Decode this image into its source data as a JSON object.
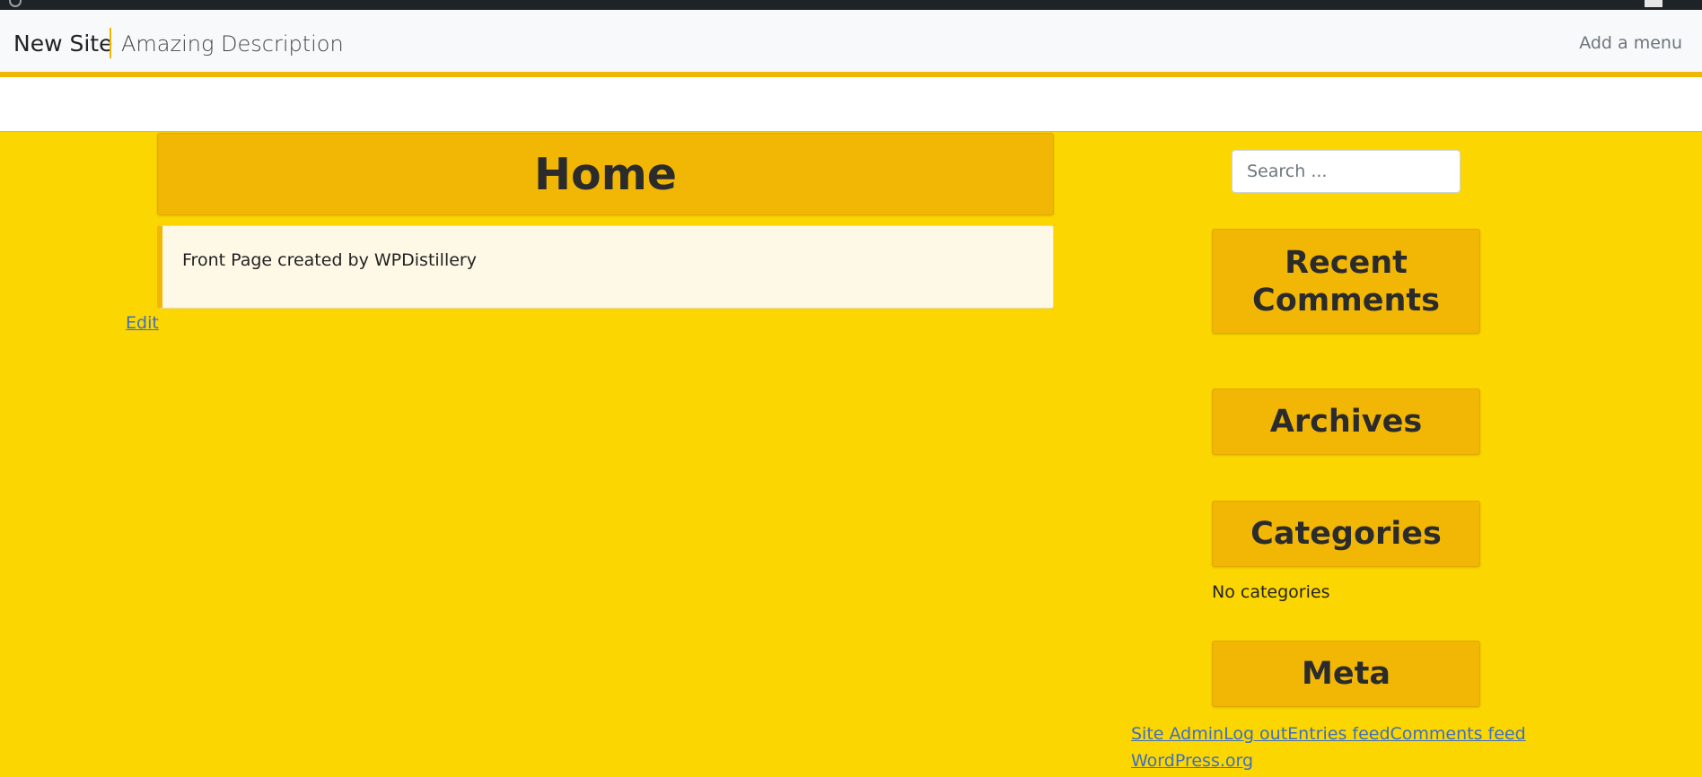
{
  "site": {
    "title": "New Site",
    "description": "Amazing Description",
    "menu_link": "Add a menu"
  },
  "page": {
    "title": "Home",
    "content": "Front Page created by WPDistillery",
    "edit_label": "Edit"
  },
  "sidebar": {
    "search_placeholder": "Search ...",
    "widgets": {
      "recent_comments": "Recent Comments",
      "archives": "Archives",
      "categories": "Categories",
      "meta": "Meta"
    },
    "categories_empty": "No categories",
    "meta_links": [
      "Site Admin",
      "Log out",
      "Entries feed",
      "Comments feed",
      "WordPress.org"
    ]
  },
  "colors": {
    "background": "#fcd600",
    "accent": "#f2b705",
    "admin_bar": "#1d2327",
    "link": "#3d6fc2"
  }
}
